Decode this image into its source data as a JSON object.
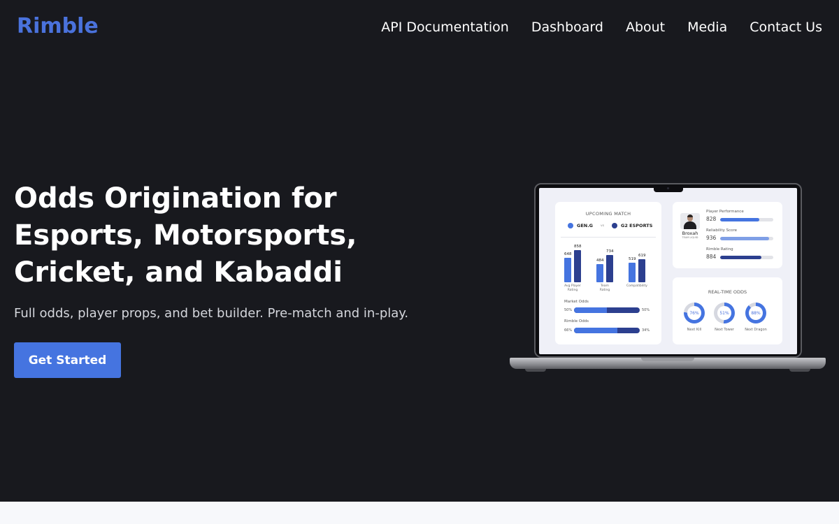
{
  "nav": {
    "logo": "Rimble",
    "links": [
      "API Documentation",
      "Dashboard",
      "About",
      "Media",
      "Contact Us"
    ]
  },
  "hero": {
    "title_lines": [
      "Odds Origination for",
      "Esports, Motorsports,",
      "Cricket, and Kabaddi"
    ],
    "subtitle": "Full odds, player props, and bet builder. Pre-match and in-play.",
    "cta": "Get Started"
  },
  "colors": {
    "background": "#18191e",
    "accent": "#4574e0",
    "dark_blue": "#2c3f8f",
    "logo": "#4a72dc"
  },
  "dashboard": {
    "upcoming": {
      "title": "UPCOMING MATCH",
      "team1": "GEN.G",
      "vs": "vs",
      "team2": "G2 ESPORTS",
      "bars": [
        {
          "label_line1": "Avg Player",
          "label_line2": "Rating",
          "a": 648,
          "b": 858
        },
        {
          "label_line1": "Team",
          "label_line2": "Rating",
          "a": 484,
          "b": 734
        },
        {
          "label_line1": "Compatibility",
          "label_line2": "",
          "a": 519,
          "b": 619
        }
      ],
      "market_odds": {
        "label": "Market Odds",
        "left": "50%",
        "right": "50%",
        "fraction": 0.5
      },
      "rimble_odds": {
        "label": "Rimble Odds",
        "left": "66%",
        "right": "34%",
        "fraction": 0.66
      }
    },
    "player": {
      "name": "Broxah",
      "team": "TEAM LIQUID",
      "stats": [
        {
          "label": "Player Performance",
          "value": "828",
          "fraction": 0.74,
          "color": "#4574e0"
        },
        {
          "label": "Reliability Score",
          "value": "936",
          "fraction": 0.92,
          "color": "#7f9fe6"
        },
        {
          "label": "Rimble Rating",
          "value": "884",
          "fraction": 0.78,
          "color": "#2c3f8f"
        }
      ]
    },
    "realtime": {
      "title": "REAL-TIME ODDS",
      "items": [
        {
          "value": "76%",
          "fraction": 0.76,
          "label": "Next Kill"
        },
        {
          "value": "51%",
          "fraction": 0.51,
          "label": "Next Tower"
        },
        {
          "value": "88%",
          "fraction": 0.88,
          "label": "Next Dragon"
        }
      ]
    }
  }
}
